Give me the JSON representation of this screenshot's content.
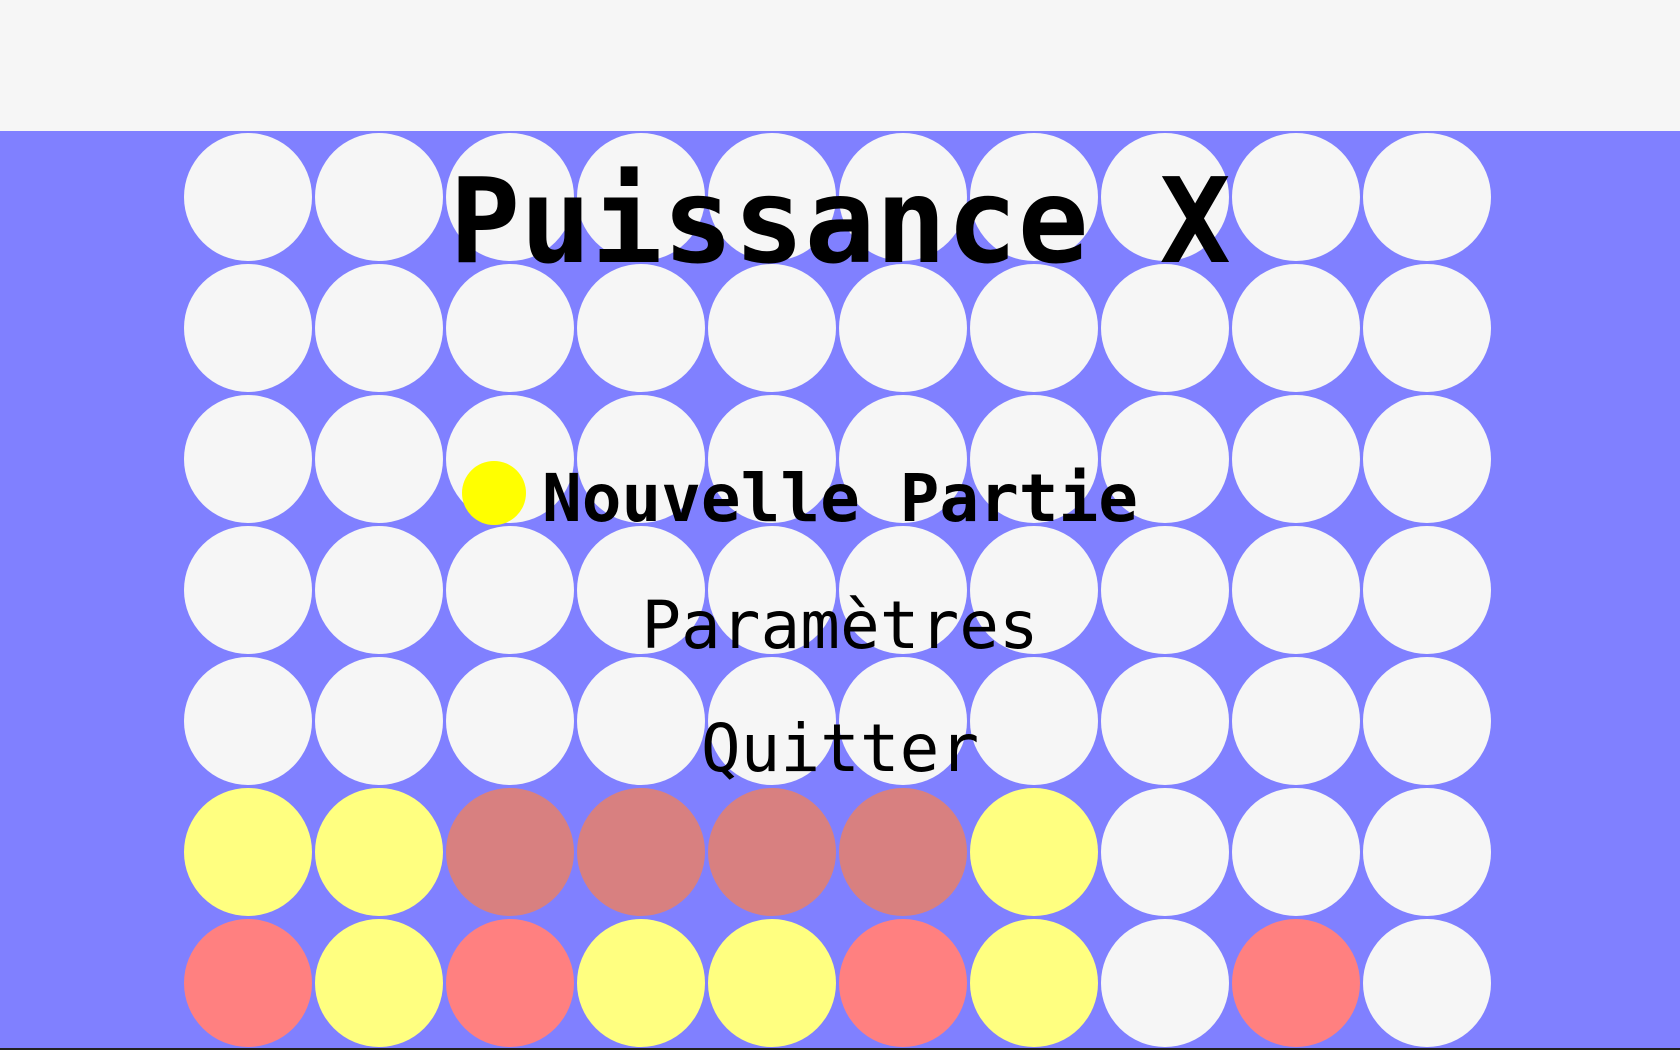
{
  "title": "Puissance X",
  "menu": {
    "items": [
      {
        "label": "Nouvelle Partie",
        "selected": true
      },
      {
        "label": "Paramètres",
        "selected": false
      },
      {
        "label": "Quitter",
        "selected": false
      }
    ]
  },
  "colors": {
    "background": "#8080ff",
    "header": "#f6f6f6",
    "empty": "#f6f6f6",
    "yellow": "#ffff80",
    "red": "#ff8080",
    "red_highlight": "#d88080",
    "selector": "#ffff00"
  },
  "board": {
    "columns": 10,
    "rows": 7,
    "cells": [
      [
        "empty",
        "empty",
        "empty",
        "empty",
        "empty",
        "empty",
        "empty",
        "empty",
        "empty",
        "empty"
      ],
      [
        "empty",
        "empty",
        "empty",
        "empty",
        "empty",
        "empty",
        "empty",
        "empty",
        "empty",
        "empty"
      ],
      [
        "empty",
        "empty",
        "empty",
        "empty",
        "empty",
        "empty",
        "empty",
        "empty",
        "empty",
        "empty"
      ],
      [
        "empty",
        "empty",
        "empty",
        "empty",
        "empty",
        "empty",
        "empty",
        "empty",
        "empty",
        "empty"
      ],
      [
        "empty",
        "empty",
        "empty",
        "empty",
        "empty",
        "empty",
        "empty",
        "empty",
        "empty",
        "empty"
      ],
      [
        "yellow",
        "yellow",
        "red_highlight",
        "red_highlight",
        "red_highlight",
        "red_highlight",
        "yellow",
        "empty",
        "empty",
        "empty"
      ],
      [
        "red",
        "yellow",
        "red",
        "yellow",
        "yellow",
        "red",
        "yellow",
        "empty",
        "red",
        "empty"
      ]
    ]
  }
}
